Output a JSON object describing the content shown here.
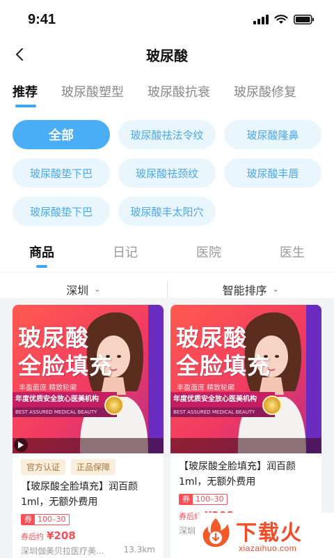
{
  "status": {
    "time": "9:41"
  },
  "nav": {
    "title": "玻尿酸"
  },
  "category_tabs": [
    {
      "label": "推荐",
      "active": true
    },
    {
      "label": "玻尿酸塑型",
      "active": false
    },
    {
      "label": "玻尿酸抗衰",
      "active": false
    },
    {
      "label": "玻尿酸修复",
      "active": false
    }
  ],
  "chips": [
    {
      "label": "全部",
      "active": true
    },
    {
      "label": "玻尿酸祛法令纹"
    },
    {
      "label": "玻尿酸隆鼻"
    },
    {
      "label": "玻尿酸垫下巴"
    },
    {
      "label": "玻尿酸祛颈纹"
    },
    {
      "label": "玻尿酸丰唇"
    },
    {
      "label": "玻尿酸垫下巴"
    },
    {
      "label": "玻尿酸丰太阳穴"
    }
  ],
  "type_tabs": [
    {
      "label": "商品",
      "active": true
    },
    {
      "label": "日记"
    },
    {
      "label": "医院"
    },
    {
      "label": "医生"
    }
  ],
  "filters": {
    "city": "深圳",
    "sort": "智能排序"
  },
  "products": [
    {
      "banner_line1": "玻尿酸",
      "banner_line2": "全脸填充",
      "banner_sub": "丰盈面庞 精致轮廓",
      "banner_strip": "年度优质安全放心医美机构",
      "banner_strip_en": "BEST ASSURED MEDICAL BEAUTY",
      "tags": [
        "官方认证",
        "正品保障"
      ],
      "title": "【玻尿酸全脸填充】润百颜1ml，无额外费用",
      "coupon_label": "券",
      "coupon_range": "100–30",
      "price_label": "券后约",
      "price": "¥208",
      "clinic": "深圳伽美贝拉医疗美...",
      "distance": "13.3km"
    },
    {
      "banner_line1": "玻尿酸",
      "banner_line2": "全脸填充",
      "banner_sub": "丰盈面庞 精致轮廓",
      "banner_strip": "年度优质安全放心医美机构",
      "banner_strip_en": "BEST ASSURED MEDICAL BEAUTY",
      "tags": [],
      "title": "【玻尿酸全脸填充】润百颜1ml，无额外费用",
      "coupon_label": "券",
      "coupon_range": "100–30",
      "price_label": "券后约",
      "price": "¥208",
      "clinic": "深圳",
      "distance": ""
    }
  ],
  "watermark": {
    "text": "下载火",
    "url": "xiazaihuo.com"
  },
  "colors": {
    "accent": "#3ba6f5",
    "chip_bg": "#eaf6fe",
    "price": "#ff4d55",
    "tag_text": "#a5753b"
  }
}
